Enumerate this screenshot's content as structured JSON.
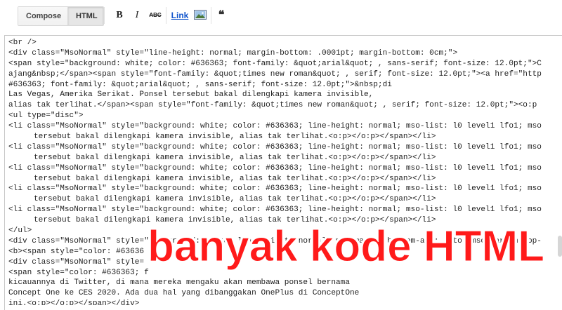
{
  "toolbar": {
    "compose_label": "Compose",
    "html_label": "HTML",
    "bold_label": "B",
    "italic_label": "I",
    "strike_label": "ABC",
    "link_label": "Link",
    "quote_label": "66"
  },
  "editor": {
    "lines": [
      "<br />",
      "<div class=\"MsoNormal\" style=\"line-height: normal; margin-bottom: .0001pt; margin-bottom: 0cm;\">",
      "<span style=\"background: white; color: #636363; font-family: &quot;arial&quot; , sans-serif; font-size: 12.0pt;\">C",
      "ajang&nbsp;</span><span style=\"font-family: &quot;times new roman&quot; , serif; font-size: 12.0pt;\"><a href=\"http",
      "#636363; font-family: &quot;arial&quot; , sans-serif; font-size: 12.0pt;\">&nbsp;di",
      "Las Vegas, Amerika Serikat. Ponsel tersebut bakal dilengkapi kamera invisible,",
      "alias tak terlihat.</span><span style=\"font-family: &quot;times new roman&quot; , serif; font-size: 12.0pt;\"><o:p",
      "<ul type=\"disc\">",
      "<li class=\"MsoNormal\" style=\"background: white; color: #636363; line-height: normal; mso-list: l0 level1 lfo1; mso",
      "tersebut bakal dilengkapi kamera invisible, alias tak terlihat.<o:p></o:p></span></li>",
      "<li class=\"MsoNormal\" style=\"background: white; color: #636363; line-height: normal; mso-list: l0 level1 lfo1; mso",
      "tersebut bakal dilengkapi kamera invisible, alias tak terlihat.<o:p></o:p></span></li>",
      "<li class=\"MsoNormal\" style=\"background: white; color: #636363; line-height: normal; mso-list: l0 level1 lfo1; mso",
      "tersebut bakal dilengkapi kamera invisible, alias tak terlihat.<o:p></o:p></span></li>",
      "<li class=\"MsoNormal\" style=\"background: white; color: #636363; line-height: normal; mso-list: l0 level1 lfo1; mso",
      "tersebut bakal dilengkapi kamera invisible, alias tak terlihat.<o:p></o:p></span></li>",
      "<li class=\"MsoNormal\" style=\"background: white; color: #636363; line-height: normal; mso-list: l0 level1 lfo1; mso",
      "tersebut bakal dilengkapi kamera invisible, alias tak terlihat.<o:p></o:p></span></li>",
      "</ul>",
      "<div class=\"MsoNormal\" style=\"background: white; line-height: normal; mso-margin-bottom-alt: auto; mso-margin-top-",
      "<b><span style=\"color: #63636",
      "<div class=\"MsoNormal\" style=",
      "<span style=\"color: #636363; f",
      "kicauannya di Twitter, di mana mereka mengaku akan membawa ponsel bernama",
      "Concept One ke CES 2020. Ada dua hal yang dibanggakan OnePlus di ConceptOne",
      "ini.<o:p></o:p></span></div>"
    ]
  },
  "overlay": {
    "text": "banyak kode HTML",
    "color": "#ff1a1a"
  },
  "colors": {
    "link": "#1155cc",
    "code_text": "#222222",
    "border": "#c8c8c8"
  }
}
